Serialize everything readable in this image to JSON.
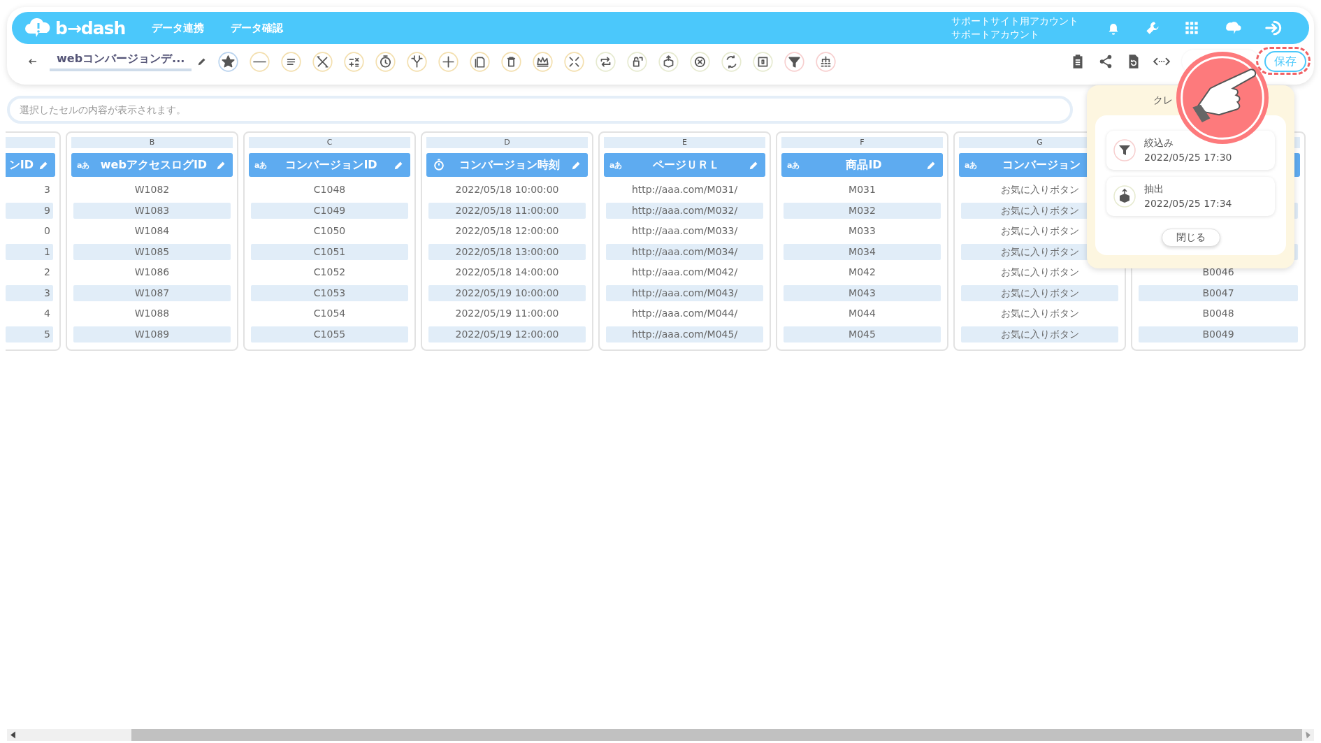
{
  "header": {
    "logo": "b→dash",
    "nav": [
      {
        "label": "データ連携"
      },
      {
        "label": "データ確認"
      }
    ],
    "account": [
      "サポートサイト用アカウント",
      "サポートアカウント"
    ]
  },
  "toolbar": {
    "title": "webコンバージョンデ...",
    "save": "保存"
  },
  "cell_bar": {
    "placeholder": "選択したセルの内容が表示されます。"
  },
  "columns": [
    {
      "kind": "partial",
      "name": "ンID",
      "cells": [
        "3",
        "9",
        "0",
        "1",
        "2",
        "3",
        "4",
        "5"
      ]
    },
    {
      "kind": "full",
      "letter": "B",
      "type_label": "aあ",
      "name": "webアクセスログID",
      "cells": [
        "W1082",
        "W1083",
        "W1084",
        "W1085",
        "W1086",
        "W1087",
        "W1088",
        "W1089"
      ]
    },
    {
      "kind": "full",
      "letter": "C",
      "type_label": "aあ",
      "name": "コンバージョンID",
      "cells": [
        "C1048",
        "C1049",
        "C1050",
        "C1051",
        "C1052",
        "C1053",
        "C1054",
        "C1055"
      ]
    },
    {
      "kind": "datetime",
      "letter": "D",
      "name": "コンバージョン時刻",
      "cells": [
        "2022/05/18 10:00:00",
        "2022/05/18 11:00:00",
        "2022/05/18 12:00:00",
        "2022/05/18 13:00:00",
        "2022/05/18 14:00:00",
        "2022/05/19 10:00:00",
        "2022/05/19 11:00:00",
        "2022/05/19 12:00:00"
      ]
    },
    {
      "kind": "full",
      "letter": "E",
      "type_label": "aあ",
      "name": "ページＵＲＬ",
      "cells": [
        "http://aaa.com/M031/",
        "http://aaa.com/M032/",
        "http://aaa.com/M033/",
        "http://aaa.com/M034/",
        "http://aaa.com/M042/",
        "http://aaa.com/M043/",
        "http://aaa.com/M044/",
        "http://aaa.com/M045/"
      ]
    },
    {
      "kind": "full",
      "letter": "F",
      "type_label": "aあ",
      "name": "商品ID",
      "cells": [
        "M031",
        "M032",
        "M033",
        "M034",
        "M042",
        "M043",
        "M044",
        "M045"
      ]
    },
    {
      "kind": "full",
      "letter": "G",
      "type_label": "aあ",
      "name": "コンバージョン",
      "cells": [
        "お気に入りボタン",
        "お気に入りボタン",
        "お気に入りボタン",
        "お気に入りボタン",
        "お気に入りボタン",
        "お気に入りボタン",
        "お気に入りボタン",
        "お気に入りボタン"
      ]
    },
    {
      "kind": "covered",
      "cells": [
        null,
        null,
        null,
        null,
        "B0046",
        "B0047",
        "B0048",
        "B0049"
      ]
    }
  ],
  "popup": {
    "title": "クレ",
    "items": [
      {
        "kind": "filter",
        "label": "絞込み",
        "time": "2022/05/25 17:30"
      },
      {
        "kind": "extract",
        "label": "抽出",
        "time": "2022/05/25 17:34"
      }
    ],
    "close": "閉じる"
  }
}
